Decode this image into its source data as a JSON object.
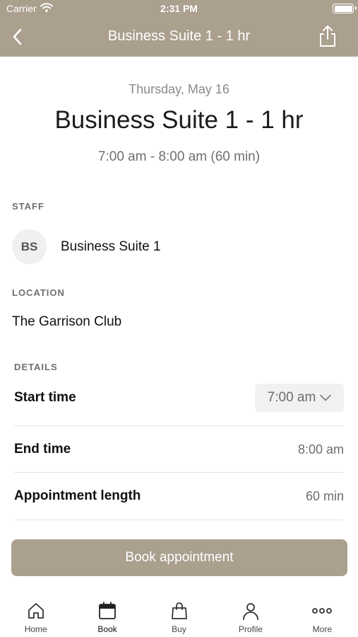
{
  "status_bar": {
    "carrier": "Carrier",
    "time": "2:31 PM"
  },
  "nav": {
    "title": "Business Suite 1 - 1 hr"
  },
  "appointment": {
    "date": "Thursday, May 16",
    "title": "Business Suite 1 - 1 hr",
    "time_range": "7:00 am - 8:00 am (60 min)"
  },
  "staff": {
    "label": "STAFF",
    "initials": "BS",
    "name": "Business Suite 1"
  },
  "location": {
    "label": "LOCATION",
    "name": "The Garrison Club"
  },
  "details": {
    "label": "DETAILS",
    "start_label": "Start time",
    "start_value": "7:00 am",
    "end_label": "End time",
    "end_value": "8:00 am",
    "length_label": "Appointment length",
    "length_value": "60 min"
  },
  "book_button": "Book appointment",
  "tabs": [
    {
      "label": "Home",
      "icon": "home-icon"
    },
    {
      "label": "Book",
      "icon": "calendar-icon"
    },
    {
      "label": "Buy",
      "icon": "shopping-bag-icon"
    },
    {
      "label": "Profile",
      "icon": "person-icon"
    },
    {
      "label": "More",
      "icon": "more-icon"
    }
  ],
  "colors": {
    "brand": "#ab9f8e"
  }
}
